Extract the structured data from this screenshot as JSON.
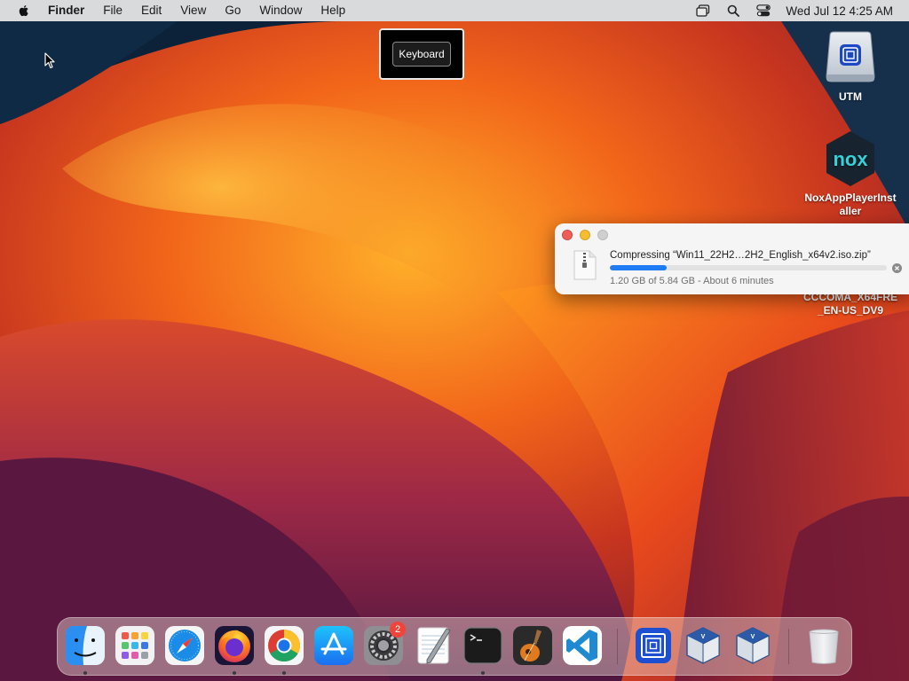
{
  "menubar": {
    "apple_icon": "apple-logo-icon",
    "items": [
      "Finder",
      "File",
      "Edit",
      "View",
      "Go",
      "Window",
      "Help"
    ],
    "status_icons": [
      "window-stack-icon",
      "search-icon",
      "control-center-icon"
    ],
    "clock": "Wed Jul 12  4:25 AM"
  },
  "hud": {
    "label": "Keyboard"
  },
  "desktop": {
    "icons": [
      {
        "label": "UTM",
        "icon": "disk-drive-icon"
      },
      {
        "label": "NoxAppPlayerInstaller",
        "line1": "NoxAppPlayerInst",
        "line2": "aller",
        "icon": "nox-icon",
        "logo_text": "nox"
      },
      {
        "label": "CCCOMA_X64FRE_EN-US_DV9",
        "line1": "CCCOMA_X64FRE",
        "line2": "_EN-US_DV9",
        "icon": "disc-image-icon"
      }
    ]
  },
  "compress_window": {
    "title": "Compressing “Win11_22H2…2H2_English_x64v2.iso.zip”",
    "status": "1.20 GB of 5.84 GB - About 6 minutes",
    "progress": 0.2055,
    "colors": {
      "progress": "#1f7cf5",
      "close": "#ed5f57",
      "minimize": "#f5bd30"
    }
  },
  "dock": {
    "apps": [
      {
        "name": "Finder",
        "icon": "finder-icon",
        "running": true
      },
      {
        "name": "Launchpad",
        "icon": "launchpad-icon",
        "running": false
      },
      {
        "name": "Safari",
        "icon": "safari-icon",
        "running": false
      },
      {
        "name": "Firefox",
        "icon": "firefox-icon",
        "running": true
      },
      {
        "name": "Google Chrome",
        "icon": "chrome-icon",
        "running": true
      },
      {
        "name": "App Store",
        "icon": "app-store-icon",
        "running": false
      },
      {
        "name": "System Settings",
        "icon": "system-settings-icon",
        "running": false,
        "badge": "2"
      },
      {
        "name": "TextEdit",
        "icon": "textedit-icon",
        "running": false
      },
      {
        "name": "Terminal",
        "icon": "terminal-icon",
        "running": true
      },
      {
        "name": "GarageBand",
        "icon": "garageband-icon",
        "running": false
      },
      {
        "name": "Visual Studio Code",
        "icon": "vscode-icon",
        "running": false
      },
      {
        "name": "UTM",
        "icon": "utm-icon",
        "running": false
      },
      {
        "name": "VirtualBox",
        "icon": "virtualbox-icon",
        "running": false
      },
      {
        "name": "VirtualBox",
        "icon": "virtualbox-icon",
        "running": false
      },
      {
        "name": "Trash",
        "icon": "trash-icon",
        "running": false
      }
    ]
  }
}
